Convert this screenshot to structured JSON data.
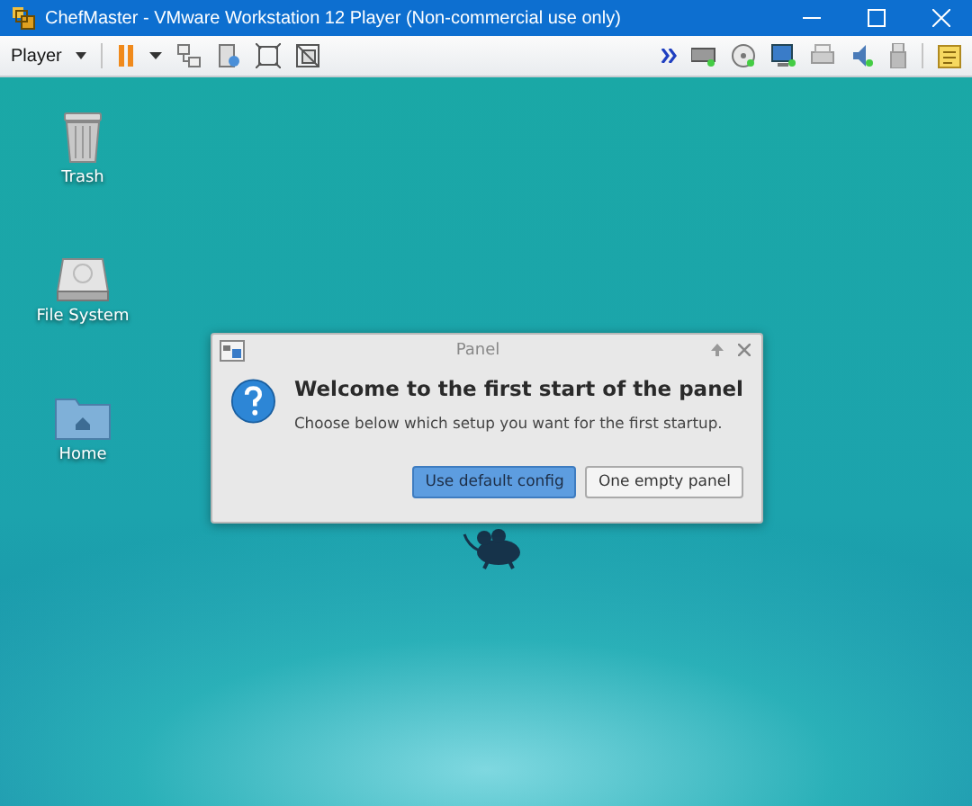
{
  "window": {
    "title": "ChefMaster - VMware Workstation 12 Player (Non-commercial use only)"
  },
  "toolbar": {
    "menu": "Player"
  },
  "desktop_icons": [
    {
      "kind": "trash",
      "label": "Trash"
    },
    {
      "kind": "drive",
      "label": "File System"
    },
    {
      "kind": "home",
      "label": "Home"
    }
  ],
  "dialog": {
    "title": "Panel",
    "heading": "Welcome to the first start of the panel",
    "message": "Choose below which setup you want for the first startup.",
    "buttons": [
      {
        "label": "Use default config",
        "selected": true
      },
      {
        "label": "One empty panel",
        "selected": false
      }
    ]
  }
}
